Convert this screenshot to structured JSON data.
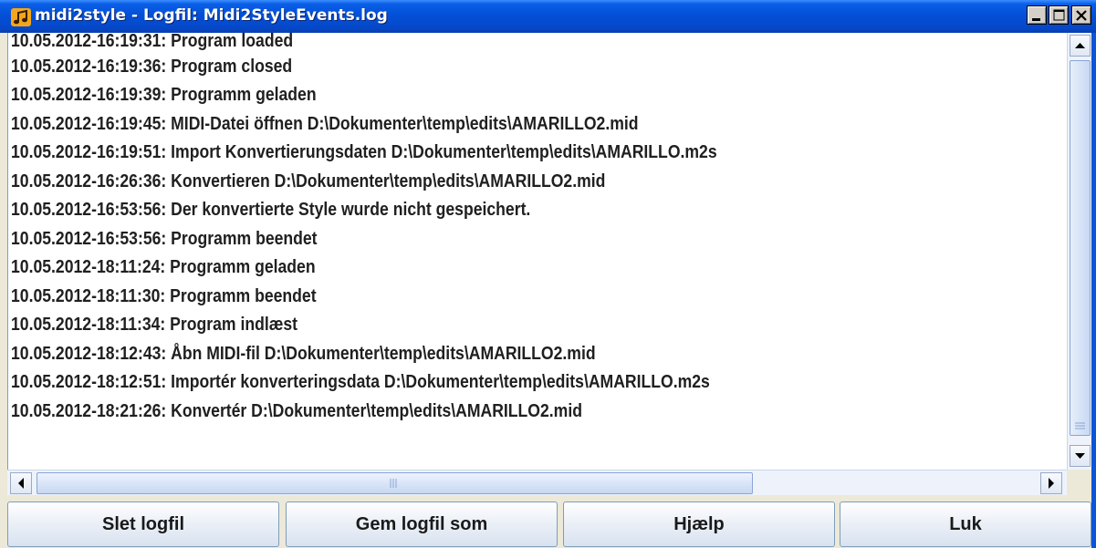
{
  "window": {
    "title": "midi2style - Logfil: Midi2StyleEvents.log",
    "icon": "music-note-icon"
  },
  "log": {
    "lines": [
      "10.05.2012-16:19:31: Program loaded",
      "10.05.2012-16:19:36: Program closed",
      "10.05.2012-16:19:39: Programm geladen",
      "10.05.2012-16:19:45: MIDI-Datei öffnen D:\\Dokumenter\\temp\\edits\\AMARILLO2.mid",
      "10.05.2012-16:19:51: Import Konvertierungsdaten D:\\Dokumenter\\temp\\edits\\AMARILLO.m2s",
      "10.05.2012-16:26:36: Konvertieren D:\\Dokumenter\\temp\\edits\\AMARILLO2.mid",
      "10.05.2012-16:53:56: Der konvertierte Style wurde nicht gespeichert.",
      "10.05.2012-16:53:56: Programm beendet",
      "10.05.2012-18:11:24: Programm geladen",
      "10.05.2012-18:11:30: Programm beendet",
      "10.05.2012-18:11:34: Program indlæst",
      "10.05.2012-18:12:43: Åbn MIDI-fil D:\\Dokumenter\\temp\\edits\\AMARILLO2.mid",
      "10.05.2012-18:12:51: Importér konverteringsdata D:\\Dokumenter\\temp\\edits\\AMARILLO.m2s",
      "10.05.2012-18:21:26: Konvertér D:\\Dokumenter\\temp\\edits\\AMARILLO2.mid"
    ]
  },
  "buttons": {
    "delete": "Slet logfil",
    "save_as": "Gem logfil som",
    "help": "Hjælp",
    "close": "Luk"
  },
  "colors": {
    "titlebar": "#0450d8",
    "background": "#ece9d8"
  }
}
